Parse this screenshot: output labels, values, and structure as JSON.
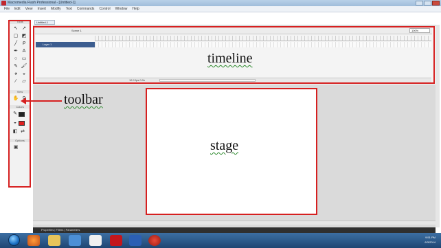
{
  "window": {
    "title": "Macromedia Flash Professional - [Untitled-1]"
  },
  "menu": [
    "File",
    "Edit",
    "View",
    "Insert",
    "Modify",
    "Text",
    "Commands",
    "Control",
    "Window",
    "Help"
  ],
  "tools": {
    "header": "Tools",
    "view_label": "View",
    "colors_label": "Colors",
    "options_label": "Options",
    "stroke_color": "#222222",
    "fill_color": "#e02020"
  },
  "document": {
    "tab": "Untitled-1",
    "scene": "Scene 1",
    "zoom": "100%",
    "layer": "Layer 1",
    "fps": "12.0 fps   0.0s"
  },
  "annotations": {
    "timeline": "timeline",
    "toolbar": "toolbar",
    "stage": "stage"
  },
  "panels": {
    "properties": "Properties | Filters | Parameters"
  },
  "taskbar": {
    "time": "9:51 PM",
    "date": "6/3/2014"
  },
  "colors": {
    "highlight_outline": "#d62020",
    "stage_bg": "#ffffff",
    "workspace_bg": "#dadada"
  }
}
